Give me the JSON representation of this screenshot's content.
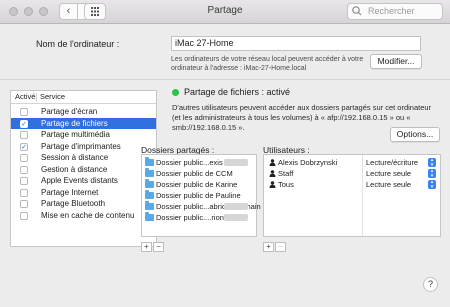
{
  "window": {
    "title": "Partage",
    "search_placeholder": "Rechercher"
  },
  "computer_name": {
    "label": "Nom de l'ordinateur :",
    "value": "iMac 27-Home",
    "hint": "Les ordinateurs de votre réseau local peuvent accéder à votre ordinateur à l'adresse : iMac-27-Home.local",
    "modify_button": "Modifier..."
  },
  "services": {
    "header_active": "Activé",
    "header_service": "Service",
    "items": [
      {
        "label": "Partage d'écran",
        "checked": false,
        "selected": false
      },
      {
        "label": "Partage de fichiers",
        "checked": true,
        "selected": true
      },
      {
        "label": "Partage multimédia",
        "checked": false,
        "selected": false
      },
      {
        "label": "Partage d'imprimantes",
        "checked": true,
        "selected": false
      },
      {
        "label": "Session à distance",
        "checked": false,
        "selected": false
      },
      {
        "label": "Gestion à distance",
        "checked": false,
        "selected": false
      },
      {
        "label": "Apple Events distants",
        "checked": false,
        "selected": false
      },
      {
        "label": "Partage Internet",
        "checked": false,
        "selected": false
      },
      {
        "label": "Partage Bluetooth",
        "checked": false,
        "selected": false
      },
      {
        "label": "Mise en cache de contenu",
        "checked": false,
        "selected": false
      }
    ]
  },
  "detail": {
    "status": "Partage de fichiers : activé",
    "description": "D'autres utilisateurs peuvent accéder aux dossiers partagés sur cet ordinateur (et les administrateurs à tous les volumes) à « afp://192.168.0.15 » ou « smb://192.168.0.15 ».",
    "options_button": "Options...",
    "shared_label": "Dossiers partagés :",
    "users_label": "Utilisateurs :",
    "shared_folders": [
      "Dossier public...exis",
      "Dossier public de CCM",
      "Dossier public de Karine",
      "Dossier public de Pauline",
      "Dossier public...abrice brochain",
      "Dossier public....rion"
    ],
    "users": [
      {
        "name": "Alexis Dobrzynski",
        "permission": "Lecture/écriture"
      },
      {
        "name": "Staff",
        "permission": "Lecture seule"
      },
      {
        "name": "Tous",
        "permission": "Lecture seule"
      }
    ],
    "add": "+",
    "remove": "−"
  },
  "help": "?",
  "colors": {
    "selection": "#2f6fde",
    "status_active": "#2ec24a",
    "folder": "#58a9e8"
  }
}
